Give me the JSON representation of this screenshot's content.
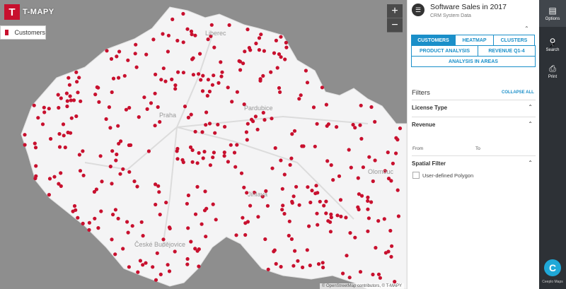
{
  "brand": {
    "name": "T-MAPY",
    "logo_letter": "T"
  },
  "legend": {
    "label": "Customers",
    "color": "#c8102e"
  },
  "zoom": {
    "in": "+",
    "out": "−"
  },
  "attribution": "© OpenStreetMap contributors, © T-MAPY",
  "cities": [
    {
      "name": "Liberec"
    },
    {
      "name": "Praha"
    },
    {
      "name": "Pardubice"
    },
    {
      "name": "Olomouc"
    },
    {
      "name": "Jihlava"
    },
    {
      "name": "České Budějovice"
    }
  ],
  "panel": {
    "title": "Software Sales in 2017",
    "subtitle": "CRM System Data",
    "icon": "database-icon",
    "tabs_row1": [
      "CUSTOMERS",
      "HEATMAP",
      "CLUSTERS"
    ],
    "tabs_row2": [
      "PRODUCT ANALYSIS",
      "REVENUE Q1-4"
    ],
    "tabs_row3": [
      "ANALYSIS IN AREAS"
    ],
    "filters": {
      "title": "Filters",
      "collapse_all": "COLLAPSE ALL",
      "license_type": "License Type",
      "revenue": "Revenue",
      "from_label": "From",
      "to_label": "To",
      "from_value": "",
      "to_value": "",
      "spatial": "Spatial Filter",
      "polygon": "User-defined Polygon"
    }
  },
  "toolbar": {
    "options": "Options",
    "search": "Search",
    "print": "Print",
    "logo_label": "Ceeplo Maps"
  },
  "colors": {
    "accent": "#1a8fc9",
    "marker": "#c8102e",
    "toolbar": "#2d3136"
  }
}
